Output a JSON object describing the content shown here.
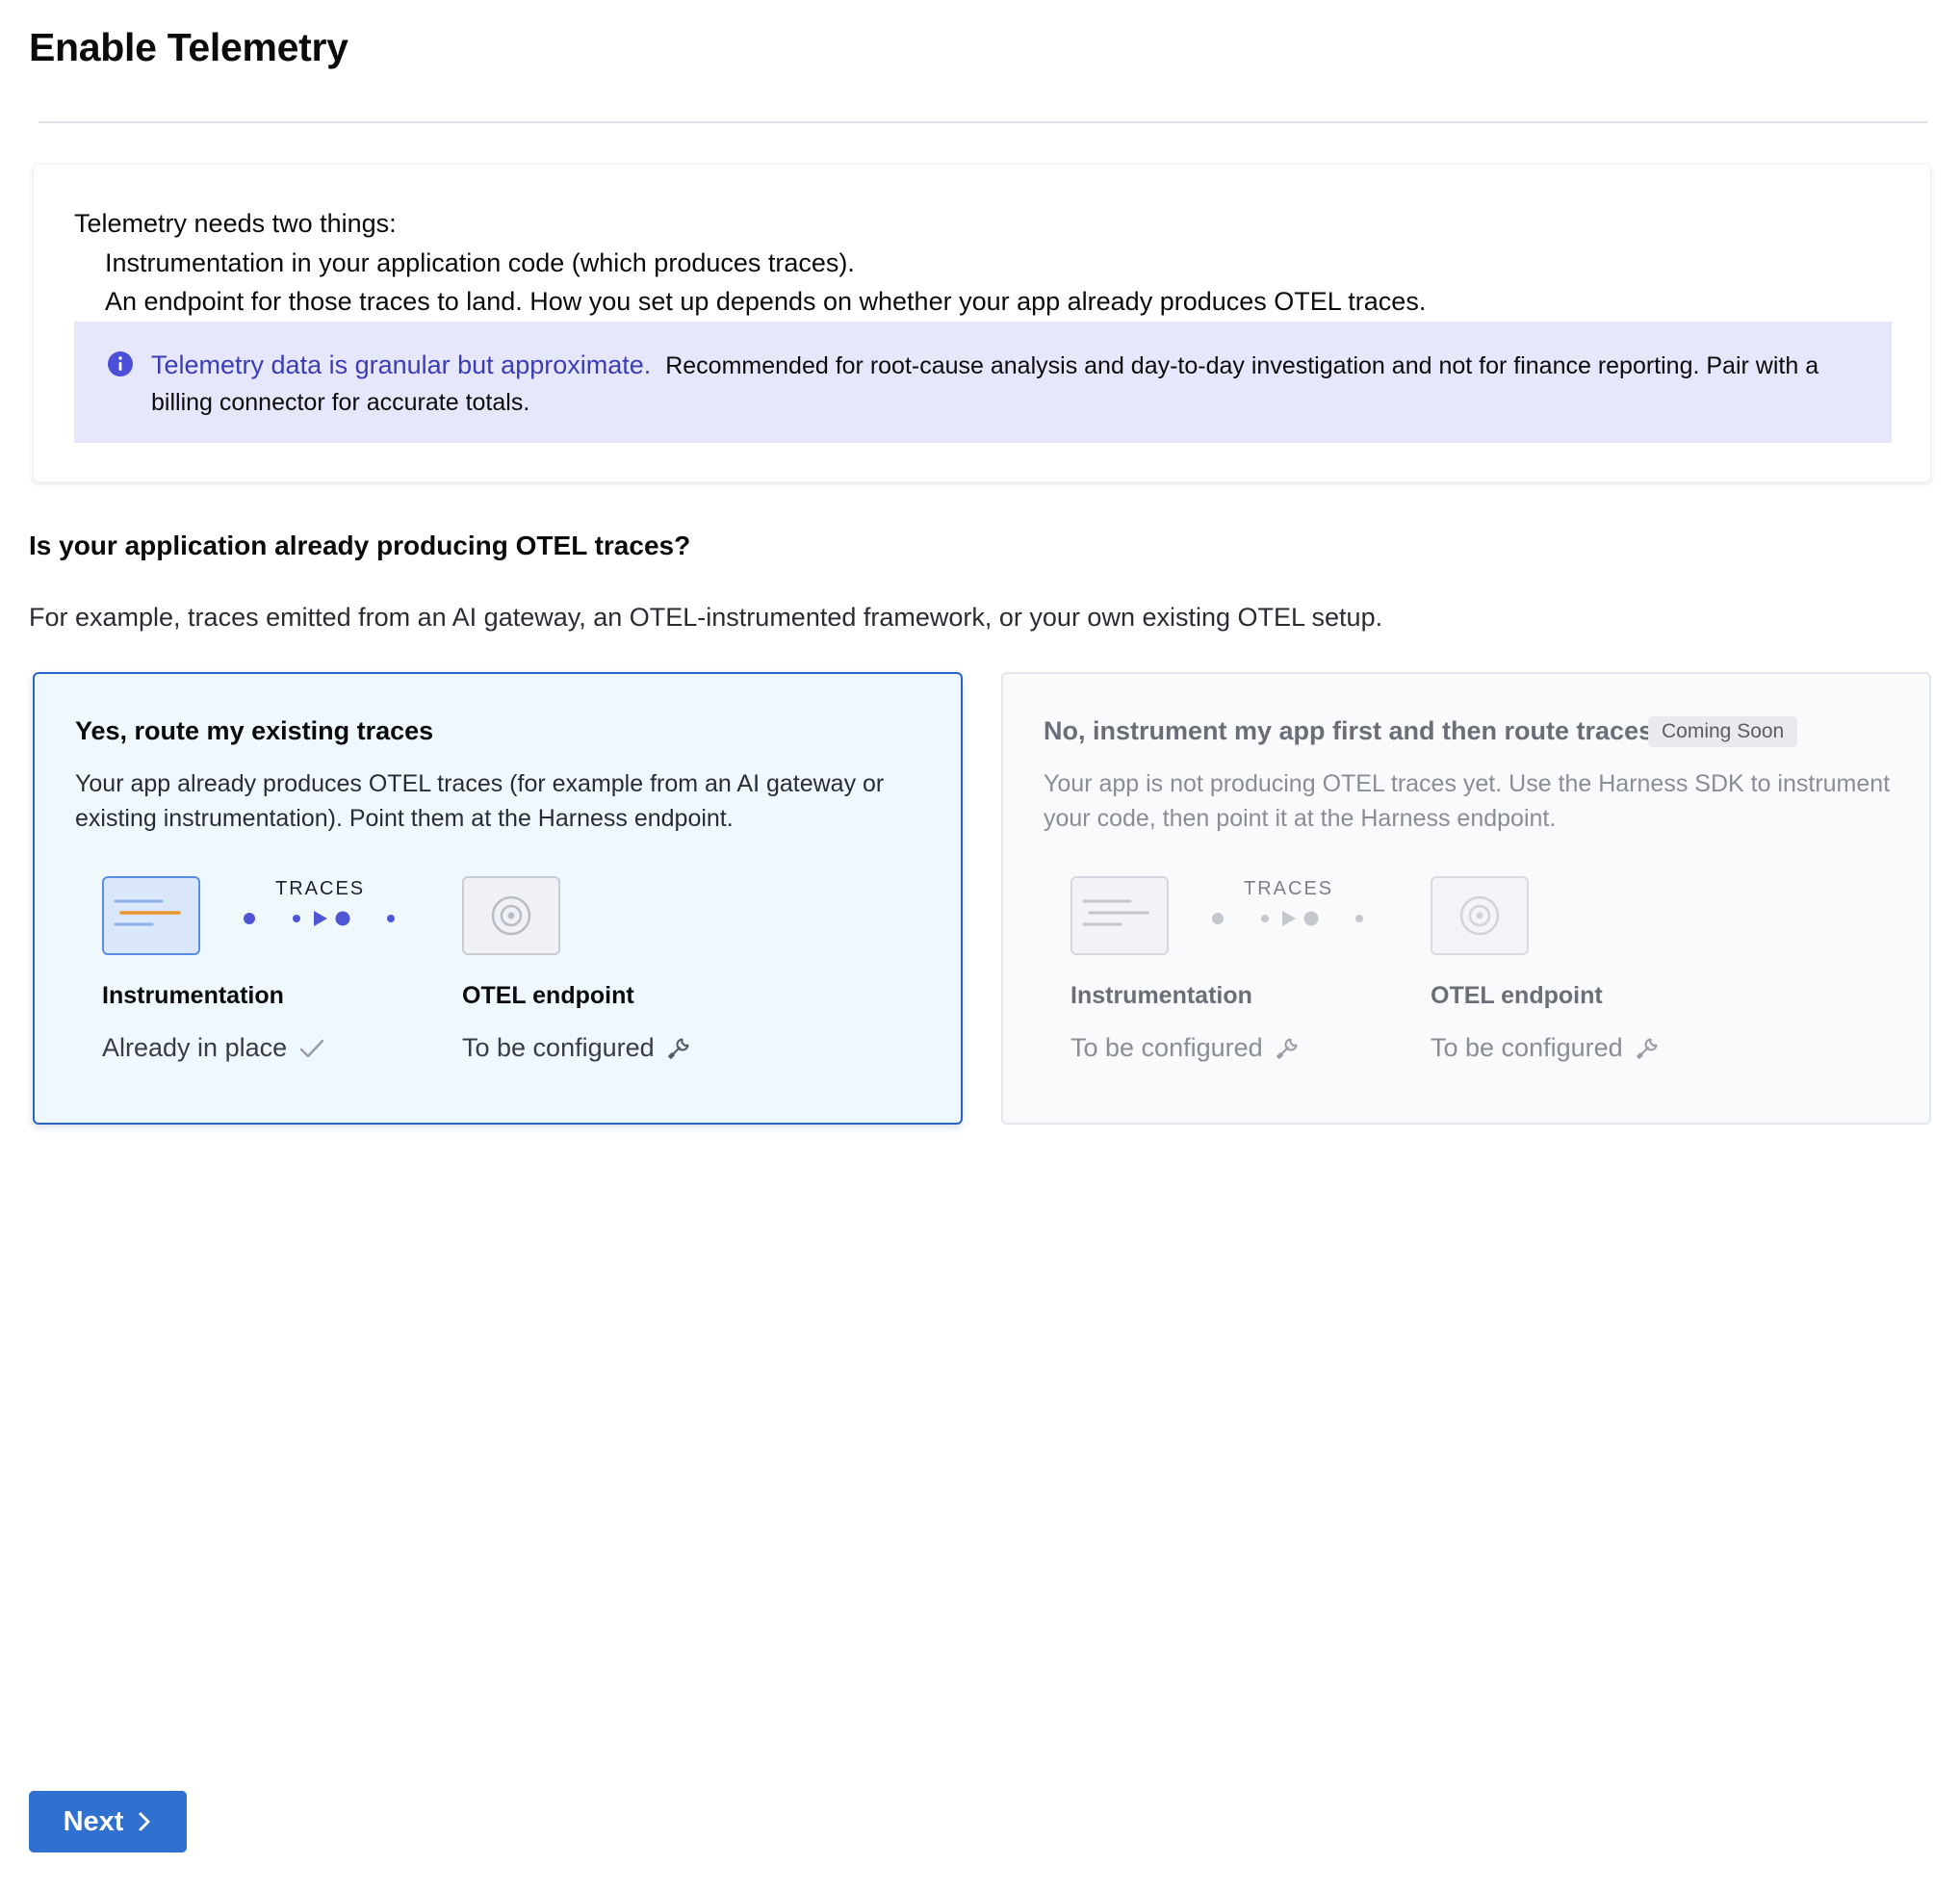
{
  "page": {
    "title": "Enable Telemetry"
  },
  "intro": {
    "lead": "Telemetry needs two things:",
    "items": [
      "Instrumentation in your application code (which produces traces).",
      "An endpoint for those traces to land. How you set up depends on whether your app already produces OTEL traces."
    ],
    "callout": {
      "icon": "info-icon",
      "title": "Telemetry data is granular but approximate.",
      "body": "Recommended for root-cause analysis and day-to-day investigation and not for finance reporting. Pair with a billing connector for accurate totals."
    }
  },
  "question": {
    "title": "Is your application already producing OTEL traces?",
    "hint": "For example, traces emitted from an AI gateway, an OTEL-instrumented framework, or your own existing OTEL setup."
  },
  "options": [
    {
      "id": "yes",
      "selected": true,
      "title": "Yes, route my existing traces",
      "description": "Your app already produces OTEL traces (for example from an AI gateway or existing instrumentation). Point them at the Harness endpoint.",
      "flow_label": "TRACES",
      "instrumentation": {
        "title": "Instrumentation",
        "status": "Already in place",
        "status_icon": "check-icon"
      },
      "endpoint": {
        "title": "OTEL endpoint",
        "status": "To be configured",
        "status_icon": "wrench-icon"
      }
    },
    {
      "id": "no",
      "selected": false,
      "disabled": true,
      "title": "No, instrument my app first and then route traces",
      "badge": "Coming Soon",
      "description": "Your app is not producing OTEL traces yet. Use the Harness SDK to instrument your code, then point it at the Harness endpoint.",
      "flow_label": "TRACES",
      "instrumentation": {
        "title": "Instrumentation",
        "status": "To be configured",
        "status_icon": "wrench-icon"
      },
      "endpoint": {
        "title": "OTEL endpoint",
        "status": "To be configured",
        "status_icon": "wrench-icon"
      }
    }
  ],
  "actions": {
    "next_label": "Next",
    "next_icon": "chevron-right-icon"
  },
  "colors": {
    "accent": "#2f70d0",
    "selected_border": "#2b65c4",
    "callout_bg": "#e7e7fb",
    "callout_title": "#3b3db5",
    "flow": "#4f56d6"
  }
}
